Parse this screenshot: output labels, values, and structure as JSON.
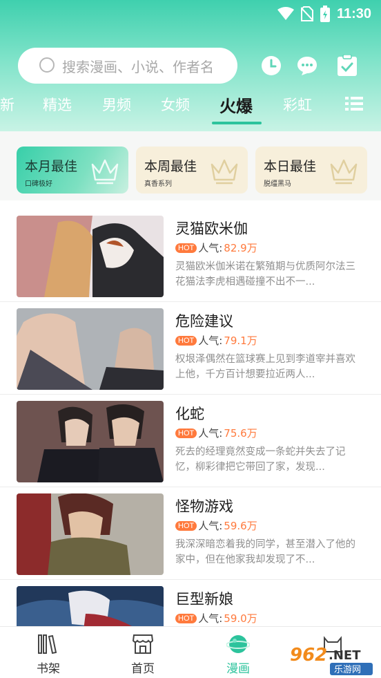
{
  "status_bar": {
    "time": "11:30"
  },
  "search": {
    "placeholder": "搜索漫画、小说、作者名"
  },
  "header_icons": [
    "clock-icon",
    "chat-icon",
    "checklist-icon"
  ],
  "tabs": [
    {
      "label": "新",
      "active": false
    },
    {
      "label": "精选",
      "active": false
    },
    {
      "label": "男频",
      "active": false
    },
    {
      "label": "女频",
      "active": false
    },
    {
      "label": "火爆",
      "active": true
    },
    {
      "label": "彩虹",
      "active": false
    }
  ],
  "rank_cards": [
    {
      "title": "本月最佳",
      "subtitle": "口碑极好"
    },
    {
      "title": "本周最佳",
      "subtitle": "真香系列"
    },
    {
      "title": "本日最佳",
      "subtitle": "脱缰黑马"
    }
  ],
  "list": [
    {
      "title": "灵猫欧米伽",
      "hot": "HOT",
      "pop_label": "人气:",
      "popularity": "82.9万",
      "desc": "灵猫欧米伽米诺在繁殖期与优质阿尔法三花猫法李虎相遇碰撞不出不一..."
    },
    {
      "title": "危险建议",
      "hot": "HOT",
      "pop_label": "人气:",
      "popularity": "79.1万",
      "desc": "权垠泽偶然在篮球赛上见到李道宰并喜欢上他，千方百计想要拉近两人..."
    },
    {
      "title": "化蛇",
      "hot": "HOT",
      "pop_label": "人气:",
      "popularity": "75.6万",
      "desc": "死去的经理竟然变成一条蛇并失去了记忆，柳彩律把它带回了家，发现..."
    },
    {
      "title": "怪物游戏",
      "hot": "HOT",
      "pop_label": "人气:",
      "popularity": "59.6万",
      "desc": "我深深暗恋着我的同学，甚至潜入了他的家中，但在他家我却发现了不..."
    },
    {
      "title": "巨型新娘",
      "hot": "HOT",
      "pop_label": "人气:",
      "popularity": "59.0万",
      "desc": ""
    }
  ],
  "bottom_nav": [
    {
      "label": "书架",
      "icon": "bookshelf-icon",
      "active": false
    },
    {
      "label": "首页",
      "icon": "store-icon",
      "active": false
    },
    {
      "label": "漫画",
      "icon": "planet-icon",
      "active": true
    },
    {
      "label": "",
      "icon": "cat-icon",
      "active": false
    }
  ],
  "watermark": {
    "text": "962.NET",
    "sub": "乐游网"
  },
  "colors": {
    "accent": "#2cc39c",
    "hot": "#ff7a3d",
    "header_top": "#3fd0ae"
  }
}
